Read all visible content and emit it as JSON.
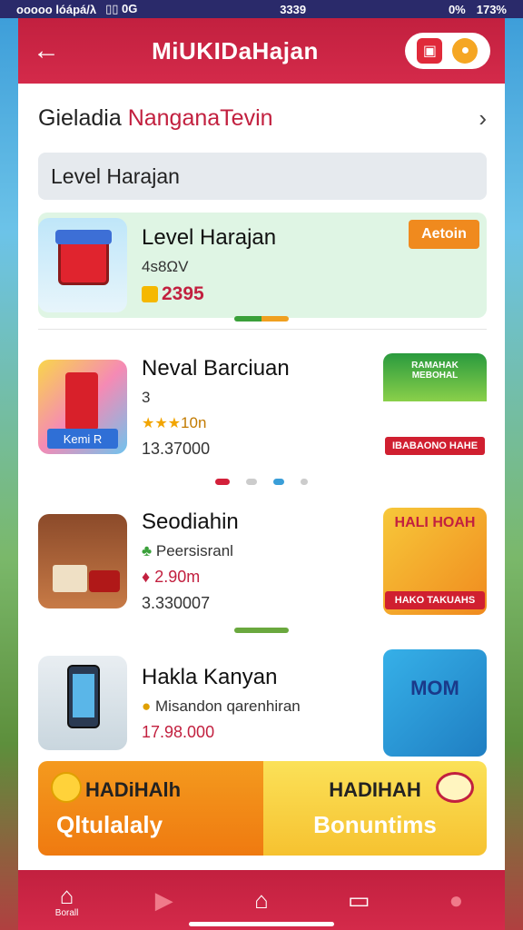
{
  "status_bar": {
    "left": "ooooo lóápá/λ",
    "icons": "▯▯ 0G",
    "time": "3339",
    "right_percent": "0%",
    "battery": "173%"
  },
  "header": {
    "title": "MiUKIDaHajan"
  },
  "section": {
    "title_part1": "Gieladia",
    "title_part2": "NanganaTevin"
  },
  "search": {
    "value": "Level Harajan"
  },
  "items": [
    {
      "name": "Level Harajan",
      "sub": "4s8ΩV",
      "price": "2395",
      "action_label": "Aetoin"
    },
    {
      "name": "Neval Barciuan",
      "sub": "3",
      "rating_text": "10n",
      "stars": "★★★",
      "price": "13.37000",
      "badge": "Kemi R",
      "promo_top": "RAMAHAK MEBOHAL",
      "promo_label": "IBABAONO HAHE"
    },
    {
      "name": "Seodiahin",
      "sub": "Peersisranl",
      "price": "2.90m",
      "price2": "3.330007",
      "promo_top": "HALI HOAH",
      "promo_label": "HAKO TAKUAHS"
    },
    {
      "name": "Hakla Kanyan",
      "sub": "Misandon qarenhiran",
      "price": "17.98.000",
      "promo_top": "MOM"
    }
  ],
  "bonus": {
    "left_title": "HADiHAlh",
    "left_sub": "Qltulalaly",
    "right_title": "HADIHAH",
    "right_sub": "Bonuntims"
  },
  "tabs": [
    {
      "label": "Borall",
      "icon": "home-icon"
    },
    {
      "label": "",
      "icon": "play-icon"
    },
    {
      "label": "",
      "icon": "house-icon"
    },
    {
      "label": "",
      "icon": "chat-icon"
    },
    {
      "label": "",
      "icon": "profile-icon"
    }
  ],
  "colors": {
    "brand_red": "#c2203f",
    "accent_orange": "#f08a1e",
    "accent_yellow": "#f6c230"
  }
}
